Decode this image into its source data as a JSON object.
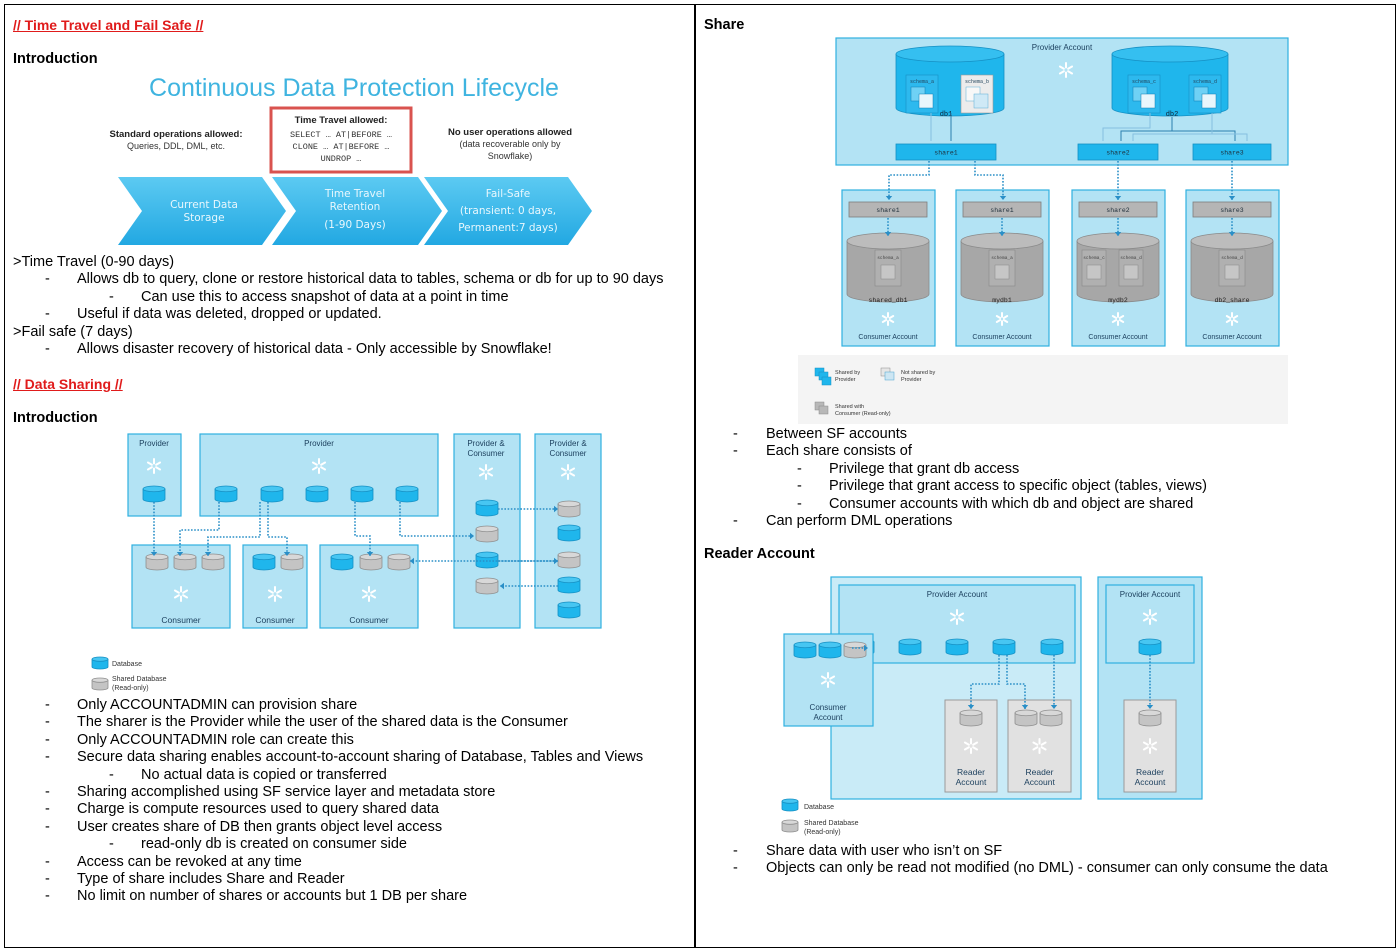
{
  "left": {
    "section1_title": "// Time Travel and Fail Safe //",
    "intro1_label": "Introduction",
    "lifecycle": {
      "title": "Continuous Data Protection Lifecycle",
      "standard_ops_title": "Standard operations allowed:",
      "standard_ops_sub": "Queries, DDL, DML, etc.",
      "tt_box_title": "Time Travel allowed:",
      "tt_box_lines": [
        "SELECT … AT|BEFORE …",
        "CLONE … AT|BEFORE …",
        "UNDROP …"
      ],
      "no_ops_title": "No user operations allowed",
      "no_ops_sub1": "(data recoverable only by",
      "no_ops_sub2": "Snowflake)",
      "arrows": [
        {
          "lines": [
            "Current Data",
            "Storage"
          ]
        },
        {
          "lines": [
            "Time Travel",
            "Retention",
            "(1-90 Days)"
          ]
        },
        {
          "lines": [
            "Fail-Safe",
            "(transient: 0 days,",
            "Permanent:7 days)"
          ]
        }
      ]
    },
    "tt_notes": [
      {
        "level": 0,
        "text": ">Time Travel (0-90 days)"
      },
      {
        "level": 1,
        "text": "Allows db to query, clone or restore historical data to tables, schema or db for up to 90 days"
      },
      {
        "level": 2,
        "text": "Can use this to access snapshot of data at a point in time"
      },
      {
        "level": 1,
        "text": "Useful if data was deleted, dropped or updated."
      },
      {
        "level": 0,
        "text": ">Fail safe (7 days)"
      },
      {
        "level": 1,
        "text": "Allows disaster recovery of historical data - Only accessible by Snowflake!"
      }
    ],
    "section2_title": "// Data Sharing //",
    "intro2_label": "Introduction",
    "sharing_diagram": {
      "provider1": "Provider",
      "provider2": "Provider",
      "pc1_line1": "Provider &",
      "pc1_line2": "Consumer",
      "pc2_line1": "Provider &",
      "pc2_line2": "Consumer",
      "consumer": "Consumer",
      "legend_db": "Database",
      "legend_shared_1": "Shared Database",
      "legend_shared_2": "(Read-only)"
    },
    "sharing_notes": [
      {
        "level": 1,
        "text": "Only ACCOUNTADMIN can provision share"
      },
      {
        "level": 1,
        "text": "The sharer is the Provider while the user of the shared data is the Consumer"
      },
      {
        "level": 1,
        "text": "Only ACCOUNTADMIN role can create this"
      },
      {
        "level": 1,
        "text": "Secure data sharing enables account-to-account sharing of Database, Tables and Views"
      },
      {
        "level": 2,
        "text": "No actual data is copied or transferred"
      },
      {
        "level": 1,
        "text": "Sharing accomplished using SF service layer and metadata store"
      },
      {
        "level": 1,
        "text": "Charge is compute resources used to query shared data"
      },
      {
        "level": 1,
        "text": "User creates share of DB then grants object level access"
      },
      {
        "level": 2,
        "text": "read-only db is created on consumer side"
      },
      {
        "level": 1,
        "text": "Access can be revoked at any time"
      },
      {
        "level": 1,
        "text": "Type of share includes Share and Reader"
      },
      {
        "level": 1,
        "text": "No limit on number of shares or accounts but 1 DB per share"
      }
    ]
  },
  "right": {
    "share_title": "Share",
    "share_diagram": {
      "provider_account": "Provider Account",
      "db1": "db1",
      "db2": "db2",
      "schemas": [
        "schema_a",
        "schema_b",
        "schema_c",
        "schema_d"
      ],
      "shares": [
        "share1",
        "share2",
        "share3"
      ],
      "consumers": [
        {
          "share": "share1",
          "schemas": [
            "schema_a"
          ],
          "db": "shared_db1",
          "label": "Consumer Account"
        },
        {
          "share": "share1",
          "schemas": [
            "schema_a"
          ],
          "db": "mydb1",
          "label": "Consumer Account"
        },
        {
          "share": "share2",
          "schemas": [
            "schema_c",
            "schema_d"
          ],
          "db": "mydb2",
          "label": "Consumer Account"
        },
        {
          "share": "share3",
          "schemas": [
            "schema_d"
          ],
          "db": "db2_share",
          "label": "Consumer Account"
        }
      ],
      "legend_shared_by_1": "Shared by",
      "legend_shared_by_2": "Provider",
      "legend_not_shared_1": "Not shared by",
      "legend_not_shared_2": "Provider",
      "legend_shared_with_1": "Shared with",
      "legend_shared_with_2": "Consumer (Read-only)"
    },
    "share_notes": [
      {
        "level": 1,
        "text": "Between SF accounts"
      },
      {
        "level": 1,
        "text": "Each share consists of"
      },
      {
        "level": 2,
        "text": "Privilege that grant db access"
      },
      {
        "level": 2,
        "text": "Privilege that grant access to specific object (tables, views)"
      },
      {
        "level": 2,
        "text": "Consumer accounts with which db and object are shared"
      },
      {
        "level": 1,
        "text": "Can perform DML operations"
      }
    ],
    "reader_title": "Reader Account",
    "reader_diagram": {
      "provider_account_1": "Provider Account",
      "provider_account_2": "Provider Account",
      "consumer_1": "Consumer",
      "consumer_2": "Account",
      "reader_1": "Reader",
      "reader_2": "Account",
      "legend_db": "Database",
      "legend_shared_1": "Shared Database",
      "legend_shared_2": "(Read-only)"
    },
    "reader_notes": [
      {
        "level": 1,
        "text": "Share data with user who isn’t on SF"
      },
      {
        "level": 1,
        "text": "Objects can only be read not modified (no DML)  - consumer can only consume the data"
      }
    ]
  },
  "colors": {
    "heading_red": "#e01b1b",
    "diagram_panel": "#b3e3f4",
    "diagram_border": "#2fb0e0",
    "database_blue": "#1fb6ec",
    "shared_gray": "#c4c4c4",
    "arrow_blue": "#2a8fc7"
  }
}
